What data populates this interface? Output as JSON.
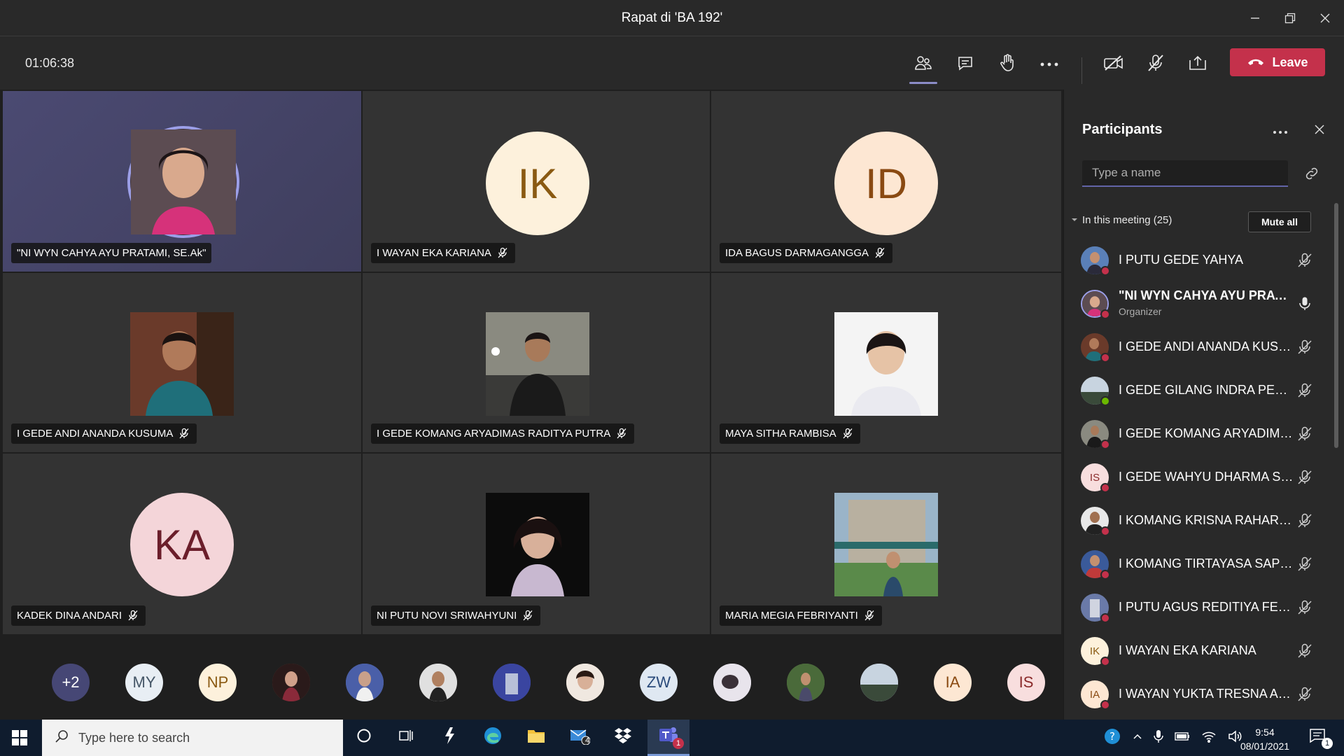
{
  "window": {
    "title": "Rapat di 'BA 192'"
  },
  "toolbar": {
    "timer": "01:06:38",
    "leave_label": "Leave"
  },
  "tiles": [
    {
      "name": "\"NI WYN CAHYA AYU PRATAMI, SE.Ak\"",
      "kind": "photo",
      "speaking": true,
      "muted": false
    },
    {
      "name": "I WAYAN EKA KARIANA",
      "kind": "initials",
      "initials": "IK",
      "bg": "#fdf1dc",
      "fg": "#8a5a12",
      "muted": true
    },
    {
      "name": "IDA BAGUS DARMAGANGGA",
      "kind": "initials",
      "initials": "ID",
      "bg": "#fde7d3",
      "fg": "#8a4a12",
      "muted": true
    },
    {
      "name": "I GEDE ANDI ANANDA KUSUMA",
      "kind": "photo",
      "muted": true
    },
    {
      "name": "I GEDE KOMANG ARYADIMAS RADITYA PUTRA",
      "kind": "photo",
      "muted": true
    },
    {
      "name": "MAYA SITHA RAMBISA",
      "kind": "photo",
      "muted": true
    },
    {
      "name": "KADEK DINA ANDARI",
      "kind": "initials",
      "initials": "KA",
      "bg": "#f4d5d9",
      "fg": "#6b1e2b",
      "muted": true
    },
    {
      "name": "NI PUTU NOVI SRIWAHYUNI",
      "kind": "photo",
      "muted": true
    },
    {
      "name": "MARIA MEGIA FEBRIYANTI",
      "kind": "photo",
      "muted": true
    }
  ],
  "strip": [
    {
      "label": "+2",
      "bg": "#464775",
      "fg": "#ffffff"
    },
    {
      "label": "MY",
      "bg": "#e8eef4",
      "fg": "#445566"
    },
    {
      "label": "NP",
      "bg": "#fdf1dc",
      "fg": "#8a5a12"
    },
    {
      "label": "",
      "bg": "#7a4a3a",
      "fg": "#ffffff"
    },
    {
      "label": "",
      "bg": "#5a6fa8",
      "fg": "#ffffff"
    },
    {
      "label": "",
      "bg": "#6b6b6b",
      "fg": "#ffffff"
    },
    {
      "label": "",
      "bg": "#4a55a0",
      "fg": "#ffffff"
    },
    {
      "label": "",
      "bg": "#c9a98a",
      "fg": "#ffffff"
    },
    {
      "label": "ZW",
      "bg": "#dfe8f2",
      "fg": "#2a4a7a"
    },
    {
      "label": "",
      "bg": "#b0a8b8",
      "fg": "#ffffff"
    },
    {
      "label": "",
      "bg": "#5a7a4a",
      "fg": "#ffffff"
    },
    {
      "label": "",
      "bg": "#7a8a9a",
      "fg": "#ffffff"
    },
    {
      "label": "IA",
      "bg": "#fde7d3",
      "fg": "#8a4a12"
    },
    {
      "label": "IS",
      "bg": "#f8dede",
      "fg": "#8a2a2a"
    }
  ],
  "panel": {
    "title": "Participants",
    "search_placeholder": "Type a name",
    "section_label": "In this meeting (25)",
    "mute_all_label": "Mute all",
    "participants": [
      {
        "name": "I PUTU GEDE YAHYA",
        "role": "",
        "avatar": "",
        "bg": "#4a6a9a",
        "status": "red",
        "mic": "muted"
      },
      {
        "name": "\"NI WYN CAHYA AYU PRATA...",
        "role": "Organizer",
        "avatar": "",
        "bg": "#8a5a6a",
        "status": "red",
        "mic": "on"
      },
      {
        "name": "I GEDE ANDI ANANDA KUSU...",
        "role": "",
        "avatar": "",
        "bg": "#5a3a2a",
        "status": "red",
        "mic": "muted"
      },
      {
        "name": "I GEDE GILANG INDRA PERD...",
        "role": "",
        "avatar": "",
        "bg": "#6a7a8a",
        "status": "green",
        "mic": "muted"
      },
      {
        "name": "I GEDE KOMANG ARYADIMAS...",
        "role": "",
        "avatar": "",
        "bg": "#7a6a5a",
        "status": "red",
        "mic": "muted"
      },
      {
        "name": "I GEDE WAHYU DHARMA SET...",
        "role": "",
        "avatar": "IS",
        "bg": "#f8dede",
        "status": "red",
        "mic": "muted"
      },
      {
        "name": "I KOMANG KRISNA RAHARJA",
        "role": "",
        "avatar": "",
        "bg": "#4a4a4a",
        "status": "red",
        "mic": "muted"
      },
      {
        "name": "I KOMANG TIRTAYASA SAPUT...",
        "role": "",
        "avatar": "",
        "bg": "#a04040",
        "status": "red",
        "mic": "muted"
      },
      {
        "name": "I PUTU AGUS REDITIYA FEBRI...",
        "role": "",
        "avatar": "",
        "bg": "#6a7aa8",
        "status": "red",
        "mic": "muted"
      },
      {
        "name": "I WAYAN EKA KARIANA",
        "role": "",
        "avatar": "IK",
        "bg": "#fdf1dc",
        "status": "red",
        "mic": "muted"
      },
      {
        "name": "I WAYAN YUKTA TRESNA AN...",
        "role": "",
        "avatar": "IA",
        "bg": "#fde7d3",
        "status": "red",
        "mic": "muted"
      }
    ]
  },
  "taskbar": {
    "search_placeholder": "Type here to search",
    "time": "9:54",
    "date": "08/01/2021",
    "mail_badge": "4",
    "teams_badge": "1",
    "notif_badge": "1"
  }
}
